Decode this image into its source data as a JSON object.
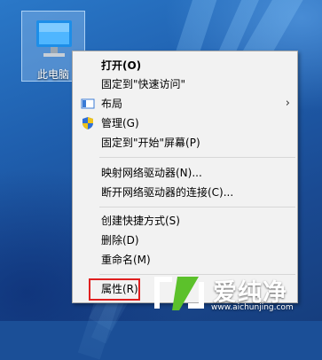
{
  "desktop": {
    "icon_label": "此电脑"
  },
  "menu": {
    "items": [
      {
        "label": "打开(O)",
        "bold": true
      },
      {
        "label": "固定到\"快速访问\""
      },
      {
        "label": "布局",
        "submenu": true,
        "icon": "layout-icon"
      },
      {
        "label": "管理(G)",
        "icon": "shield-icon"
      },
      {
        "label": "固定到\"开始\"屏幕(P)"
      },
      {
        "label": "映射网络驱动器(N)..."
      },
      {
        "label": "断开网络驱动器的连接(C)..."
      },
      {
        "label": "创建快捷方式(S)"
      },
      {
        "label": "删除(D)"
      },
      {
        "label": "重命名(M)"
      },
      {
        "label": "属性(R)",
        "highlighted": true
      }
    ],
    "submenu_arrow": "›"
  },
  "watermark": {
    "title": "爱纯净",
    "url": "www.aichunjing.com"
  },
  "colors": {
    "highlight": "#e02020",
    "menu_bg": "#f2f2f2"
  }
}
